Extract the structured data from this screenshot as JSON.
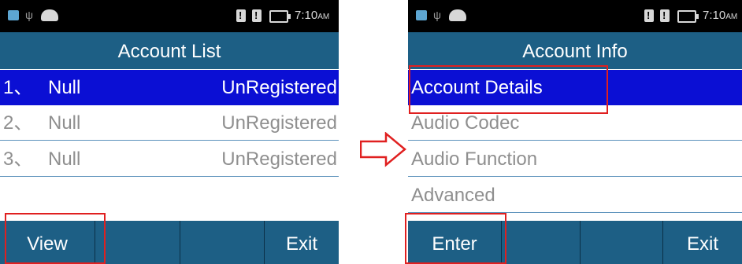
{
  "status_bar": {
    "time": "7:10",
    "ampm_left": "AM",
    "ampm_right": "AM"
  },
  "left_screen": {
    "title": "Account List",
    "accounts": [
      {
        "number": "1、",
        "name": "Null",
        "status": "UnRegistered"
      },
      {
        "number": "2、",
        "name": "Null",
        "status": "UnRegistered"
      },
      {
        "number": "3、",
        "name": "Null",
        "status": "UnRegistered"
      }
    ],
    "softkeys": {
      "left": "View",
      "right": "Exit"
    }
  },
  "right_screen": {
    "title": "Account Info",
    "items": [
      "Account Details",
      "Audio Codec",
      "Audio Function",
      "Advanced"
    ],
    "softkeys": {
      "left": "Enter",
      "right": "Exit"
    }
  },
  "colors": {
    "title_bar": "#1d5f85",
    "selected_row": "#0b0fd4",
    "highlight_box": "#e02020",
    "divider": "#5b91bb"
  }
}
